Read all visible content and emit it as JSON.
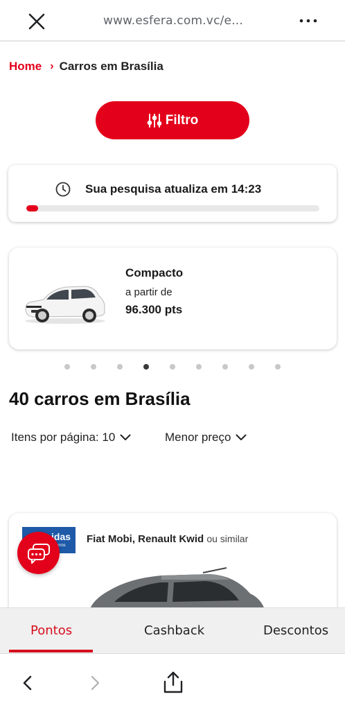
{
  "browser": {
    "url": "www.esfera.com.vc/e...",
    "close_icon": "close-icon",
    "menu_icon": "more-vertical-icon"
  },
  "breadcrumb": {
    "home": "Home",
    "separator": "›",
    "current": "Carros em Brasília"
  },
  "filter": {
    "label": "Filtro",
    "icon": "sliders-icon"
  },
  "timer": {
    "text": "Sua pesquisa atualiza em 14:23",
    "progress_percent": 4,
    "icon": "clock-icon"
  },
  "category_card": {
    "name": "Compacto",
    "from_label": "a partir de",
    "price": "96.300 pts",
    "image": "white-hatchback-car"
  },
  "carousel": {
    "total_dots": 9,
    "active_index": 3
  },
  "results": {
    "title": "40 carros em Brasília",
    "per_page_label": "Itens por página: 10",
    "sort_label": "Menor preço"
  },
  "offer": {
    "brand_text": "idas",
    "brand_sub": "carros",
    "title": "Fiat Mobi, Renault Kwid",
    "similar": "ou similar",
    "image": "dark-gray-hatchback-car"
  },
  "tabs": [
    {
      "label": "Pontos",
      "active": true
    },
    {
      "label": "Cashback",
      "active": false
    },
    {
      "label": "Descontos",
      "active": false
    }
  ],
  "colors": {
    "accent": "#e3001b",
    "tab_active": "#d50f1c"
  }
}
